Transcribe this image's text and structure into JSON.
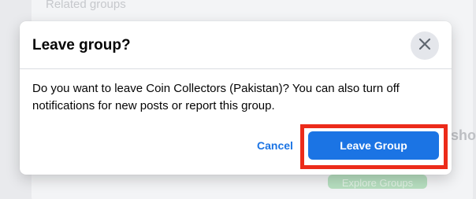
{
  "background": {
    "section_heading": "Related groups",
    "side_text": "sho",
    "green_button_label": "Explore Groups"
  },
  "dialog": {
    "title": "Leave group?",
    "close_icon": "close-icon",
    "message": "Do you want to leave Coin Collectors (Pakistan)? You can also turn off notifications for new posts or report this group.",
    "cancel_label": "Cancel",
    "confirm_label": "Leave Group"
  },
  "colors": {
    "primary_blue": "#1b74e4",
    "highlight_red": "#ec2b1a"
  }
}
